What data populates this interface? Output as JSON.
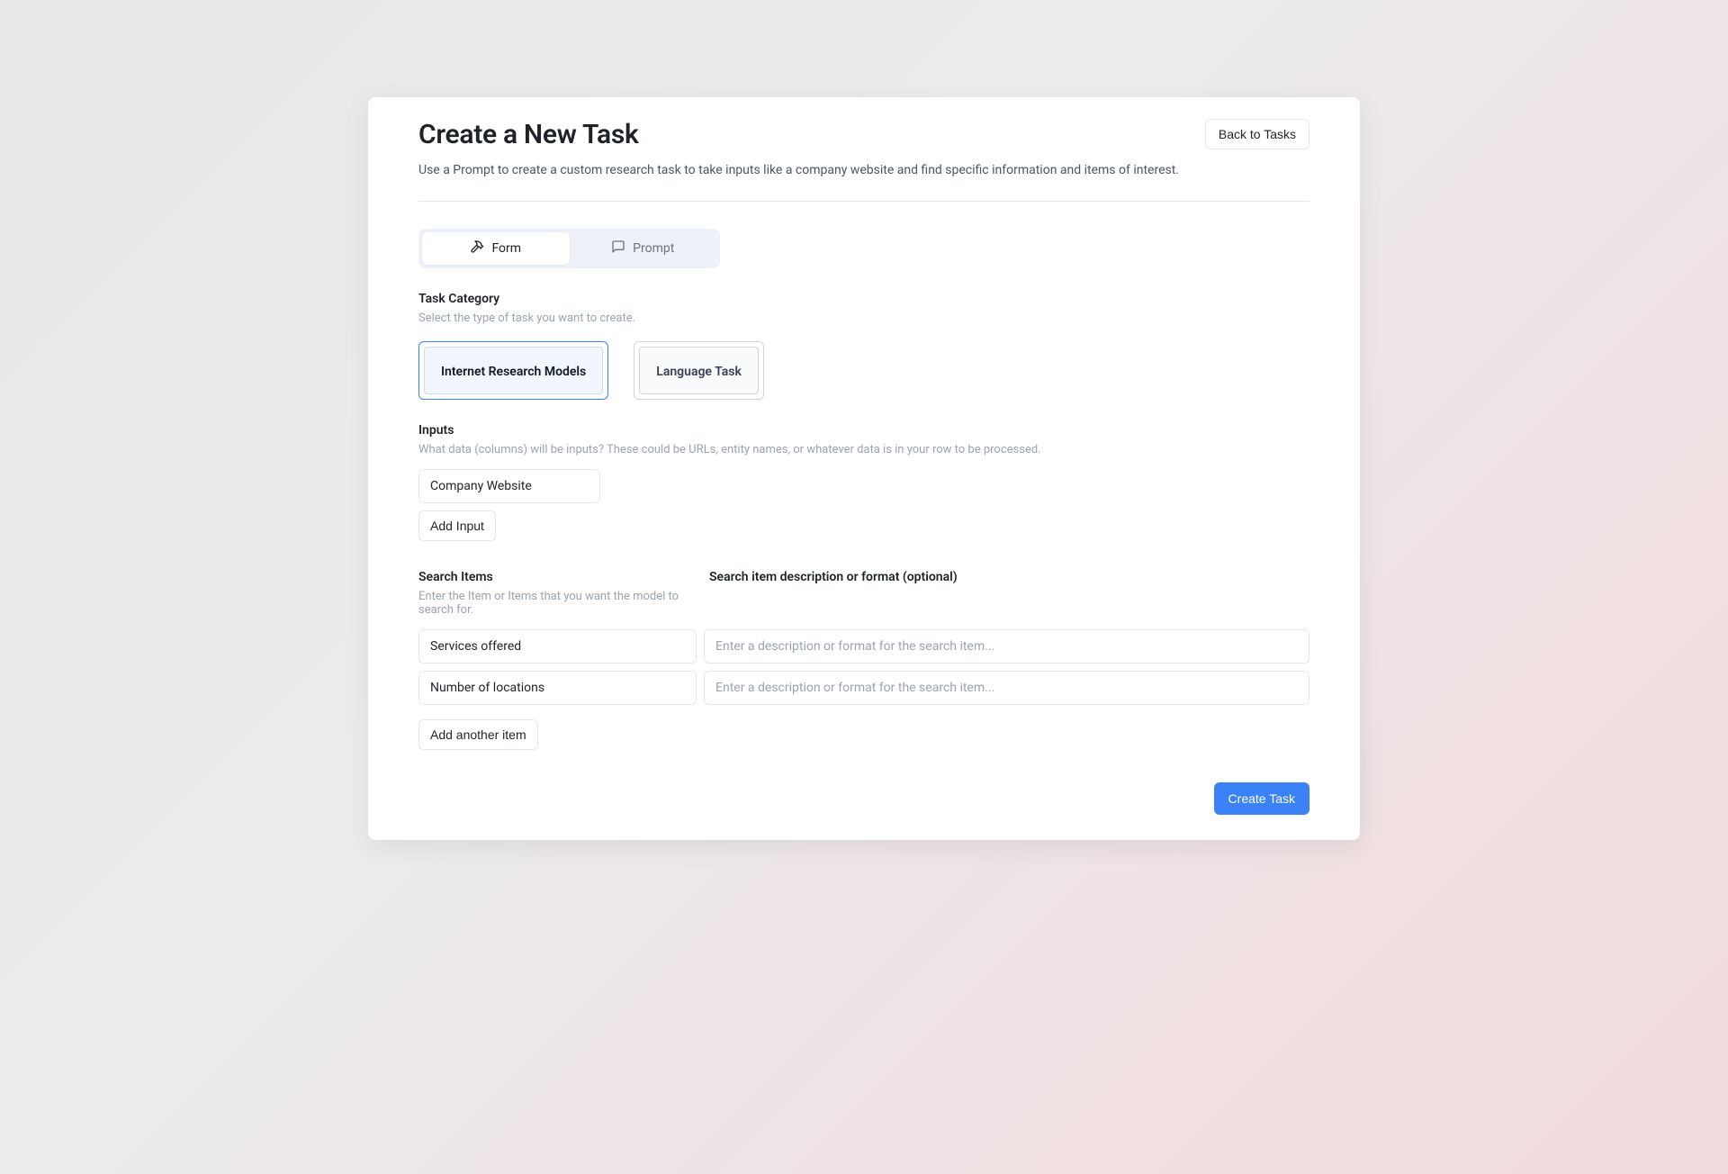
{
  "header": {
    "title": "Create a New Task",
    "back_label": "Back to Tasks",
    "description": "Use a Prompt to create a custom research task to take inputs like a company website and find specific information and items of interest."
  },
  "tabs": {
    "form_label": "Form",
    "prompt_label": "Prompt"
  },
  "task_category": {
    "title": "Task Category",
    "description": "Select the type of task you want to create.",
    "options": [
      {
        "label": "Internet Research Models",
        "selected": true
      },
      {
        "label": "Language Task",
        "selected": false
      }
    ]
  },
  "inputs": {
    "title": "Inputs",
    "description": "What data (columns) will be inputs? These could be URLs, entity names, or whatever data is in your row to be processed.",
    "items": [
      {
        "value": "Company Website"
      }
    ],
    "add_label": "Add Input"
  },
  "search_items": {
    "title": "Search Items",
    "description": "Enter the Item or Items that you want the model to search for.",
    "desc_col_title": "Search item description or format (optional)",
    "desc_placeholder": "Enter a description or format for the search item...",
    "rows": [
      {
        "item": "Services offered",
        "description": ""
      },
      {
        "item": "Number of locations",
        "description": ""
      }
    ],
    "add_label": "Add another item"
  },
  "footer": {
    "create_label": "Create Task"
  }
}
